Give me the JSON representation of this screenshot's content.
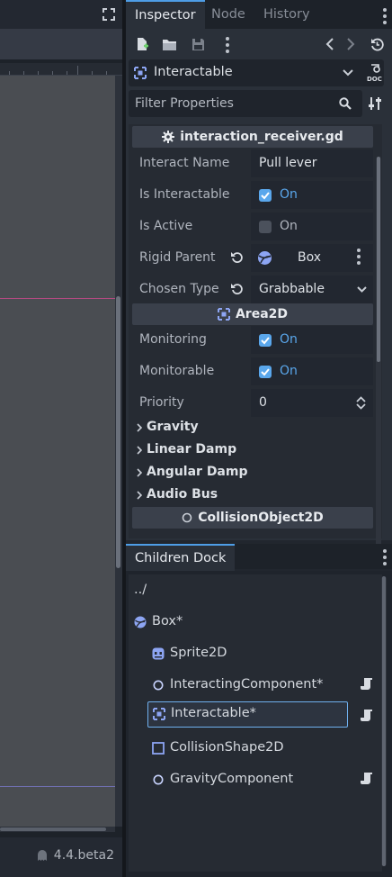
{
  "editor": {
    "version": "4.4.beta2"
  },
  "tabs": {
    "inspector": "Inspector",
    "node": "Node",
    "history": "History"
  },
  "inspector": {
    "selected_node": "Interactable",
    "filter_placeholder": "Filter Properties",
    "script_section": "interaction_receiver.gd",
    "properties": {
      "interact_name": {
        "label": "Interact Name",
        "value": "Pull lever"
      },
      "is_interactable": {
        "label": "Is Interactable",
        "state": "On"
      },
      "is_active": {
        "label": "Is Active",
        "state": "On"
      },
      "rigid_parent": {
        "label": "Rigid Parent",
        "value": "Box"
      },
      "chosen_type": {
        "label": "Chosen Type",
        "value": "Grabbable"
      }
    },
    "area_section": "Area2D",
    "area": {
      "monitoring": {
        "label": "Monitoring",
        "state": "On"
      },
      "monitorable": {
        "label": "Monitorable",
        "state": "On"
      },
      "priority": {
        "label": "Priority",
        "value": "0"
      }
    },
    "groups": [
      "Gravity",
      "Linear Damp",
      "Angular Damp",
      "Audio Bus"
    ],
    "collision_section": "CollisionObject2D"
  },
  "dock": {
    "title": "Children Dock",
    "items": [
      {
        "label": "../"
      },
      {
        "label": "Box*"
      },
      {
        "label": "Sprite2D"
      },
      {
        "label": "InteractingComponent*"
      },
      {
        "label": "Interactable*"
      },
      {
        "label": "CollisionShape2D"
      },
      {
        "label": "GravityComponent"
      }
    ]
  },
  "colors": {
    "accent": "#4e9de6",
    "checkbox_on": "#5aa7ec",
    "panel": "#2a3039",
    "background": "#1d2229"
  }
}
